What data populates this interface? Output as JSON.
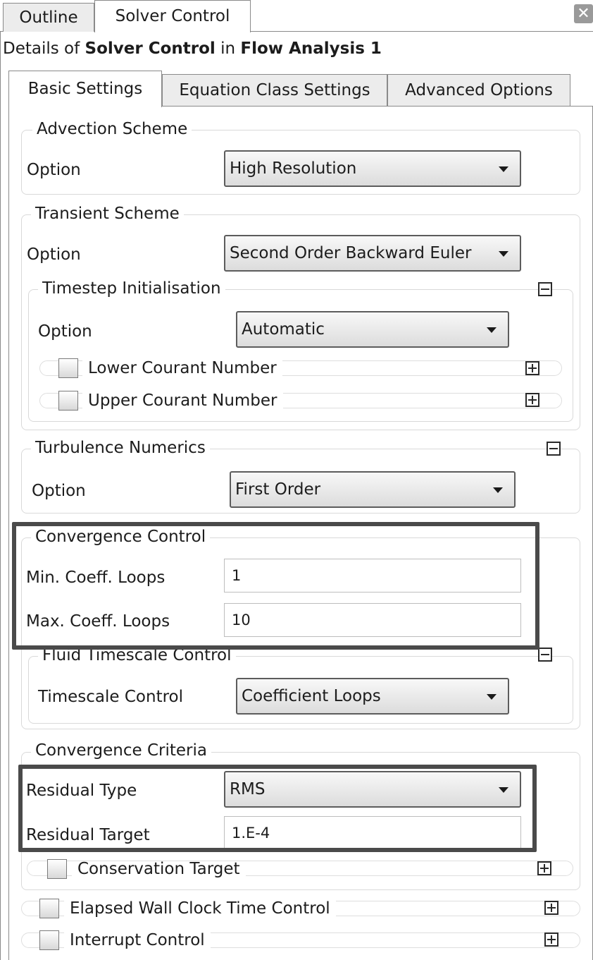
{
  "window": {
    "tabs": [
      {
        "label": "Outline",
        "active": false
      },
      {
        "label": "Solver Control",
        "active": true
      }
    ],
    "close_icon": "close-icon"
  },
  "details": {
    "prefix": "Details of ",
    "object": "Solver Control",
    "middle": " in ",
    "context": "Flow Analysis 1"
  },
  "inner_tabs": [
    {
      "label": "Basic Settings",
      "active": true
    },
    {
      "label": "Equation Class Settings",
      "active": false
    },
    {
      "label": "Advanced Options",
      "active": false
    }
  ],
  "advection": {
    "title": "Advection Scheme",
    "option_label": "Option",
    "option_value": "High Resolution"
  },
  "transient": {
    "title": "Transient Scheme",
    "option_label": "Option",
    "option_value": "Second Order Backward Euler",
    "timestep": {
      "title": "Timestep Initialisation",
      "toggle": "collapse",
      "option_label": "Option",
      "option_value": "Automatic",
      "lower_courant": {
        "label": "Lower Courant Number",
        "checked": false,
        "toggle": "expand"
      },
      "upper_courant": {
        "label": "Upper Courant Number",
        "checked": false,
        "toggle": "expand"
      }
    }
  },
  "turbulence": {
    "title": "Turbulence Numerics",
    "toggle": "collapse",
    "option_label": "Option",
    "option_value": "First Order"
  },
  "convergence_control": {
    "title": "Convergence Control",
    "min_label": "Min. Coeff. Loops",
    "min_value": "1",
    "max_label": "Max. Coeff. Loops",
    "max_value": "10",
    "fluid_timescale": {
      "title": "Fluid Timescale Control",
      "toggle": "collapse",
      "control_label": "Timescale Control",
      "control_value": "Coefficient Loops"
    }
  },
  "convergence_criteria": {
    "title": "Convergence Criteria",
    "residual_type_label": "Residual Type",
    "residual_type_value": "RMS",
    "residual_target_label": "Residual Target",
    "residual_target_value": "1.E-4",
    "conservation_target": {
      "label": "Conservation Target",
      "checked": false,
      "toggle": "expand"
    }
  },
  "elapsed_wall_clock": {
    "label": "Elapsed Wall Clock Time Control",
    "checked": false,
    "toggle": "expand"
  },
  "interrupt_control": {
    "label": "Interrupt Control",
    "checked": false,
    "toggle": "expand"
  },
  "colors": {
    "highlight_border": "#4a4a4a",
    "panel_border": "#8a8a8a",
    "group_border": "#d9d9d9"
  }
}
